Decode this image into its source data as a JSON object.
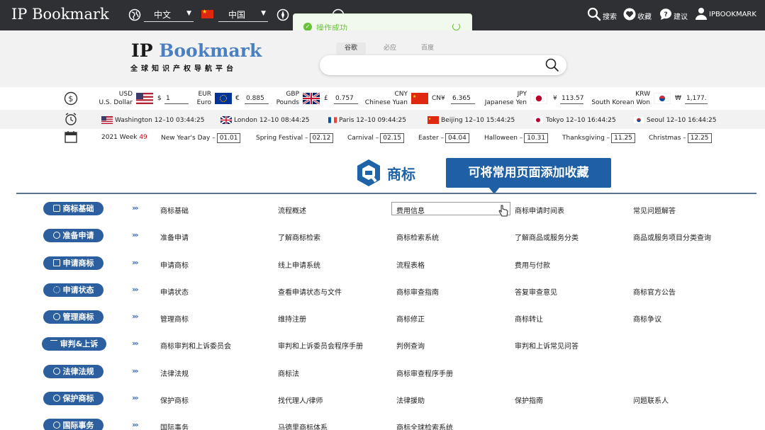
{
  "brand": "IP Bookmark",
  "topbar": {
    "language": "中文",
    "country": "中国",
    "search_label": "搜索",
    "favorites_label": "收藏",
    "suggest_label": "建议",
    "user_label": "IPBOOKMARK"
  },
  "toast": {
    "message": "操作成功"
  },
  "logo": {
    "ip": "IP",
    "bookmark": "Bookmark",
    "subtitle": "全球知识产权导航平台"
  },
  "search_tabs": [
    "谷歌",
    "必应",
    "百度"
  ],
  "currencies": [
    {
      "code": "USD",
      "name": "U.S. Dollar",
      "symbol": "$",
      "value": "1"
    },
    {
      "code": "EUR",
      "name": "Euro",
      "symbol": "€",
      "value": "0.885"
    },
    {
      "code": "GBP",
      "name": "Pounds",
      "symbol": "£",
      "value": "0.757"
    },
    {
      "code": "CNY",
      "name": "Chinese Yuan",
      "symbol": "CN¥",
      "value": "6.365"
    },
    {
      "code": "JPY",
      "name": "Japanese Yen",
      "symbol": "¥",
      "value": "113.57"
    },
    {
      "code": "KRW",
      "name": "South Korean Won",
      "symbol": "₩",
      "value": "1,177."
    }
  ],
  "clocks": [
    "Washington 12–10 03:44:25",
    "London 12–10 08:44:25",
    "Paris 12–10 09:44:25",
    "Beijing 12–10 15:44:25",
    "Tokyo 12–10 16:44:25",
    "Seoul 12–10 16:44:25"
  ],
  "week": {
    "label": "2021 Week",
    "number": "49"
  },
  "holidays": [
    {
      "name": "New Year's Day –",
      "date": "01.01"
    },
    {
      "name": "Spring Festival –",
      "date": "02.12"
    },
    {
      "name": "Carnival –",
      "date": "02.15"
    },
    {
      "name": "Easter –",
      "date": "04.04"
    },
    {
      "name": "Halloween –",
      "date": "10.31"
    },
    {
      "name": "Thanksgiving –",
      "date": "11.25"
    },
    {
      "name": "Christmas –",
      "date": "12.25"
    }
  ],
  "section": {
    "title": "商标"
  },
  "tooltip": {
    "text": "可将常用页面添加收藏"
  },
  "categories": [
    {
      "label": "商标基础",
      "links": [
        "商标基础",
        "流程概述",
        "费用信息",
        "商标申请时间表",
        "常见问题解答"
      ]
    },
    {
      "label": "准备申请",
      "links": [
        "准备申请",
        "了解商标检索",
        "商标检索系统",
        "了解商品或服务分类",
        "商品或服务项目分类查询"
      ]
    },
    {
      "label": "申请商标",
      "links": [
        "申请商标",
        "线上申请系统",
        "流程表格",
        "费用与付款",
        ""
      ]
    },
    {
      "label": "申请状态",
      "links": [
        "申请状态",
        "查看申请状态与文件",
        "商标审查指南",
        "答复审查意见",
        "商标官方公告"
      ]
    },
    {
      "label": "管理商标",
      "links": [
        "管理商标",
        "维持注册",
        "商标修正",
        "商标转让",
        "商标争议"
      ]
    },
    {
      "label": "审判&上诉",
      "links": [
        "商标审判和上诉委员会",
        "审判和上诉委员会程序手册",
        "判例查询",
        "审判和上诉常见问答",
        ""
      ]
    },
    {
      "label": "法律法规",
      "links": [
        "法律法规",
        "商标法",
        "商标审查程序手册",
        "",
        ""
      ]
    },
    {
      "label": "保护商标",
      "links": [
        "保护商标",
        "找代理人/律师",
        "法律援助",
        "保护指南",
        "问题联系人"
      ]
    },
    {
      "label": "国际事务",
      "links": [
        "国际事务",
        "马德里商标体系",
        "商标全球检索系统",
        "",
        ""
      ]
    }
  ]
}
